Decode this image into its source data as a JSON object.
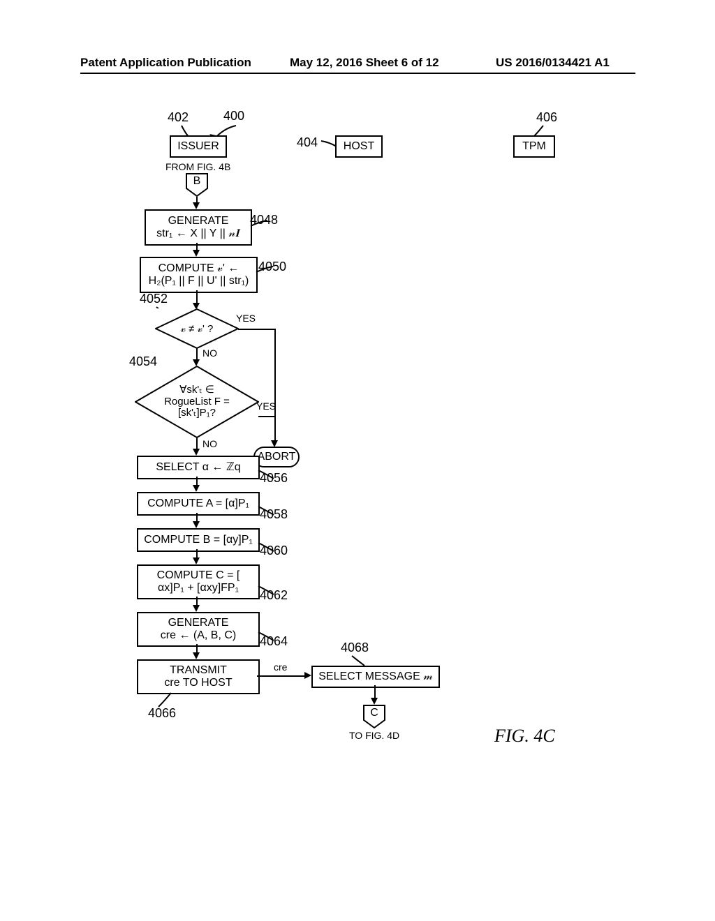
{
  "header": {
    "left": "Patent Application Publication",
    "center": "May 12, 2016   Sheet 6 of 12",
    "right": "US 2016/0134421 A1"
  },
  "entities": {
    "issuer": "ISSUER",
    "host": "HOST",
    "tpm": "TPM"
  },
  "refs": {
    "r400": "400",
    "r402": "402",
    "r404": "404",
    "r406": "406",
    "r4048": "4048",
    "r4050": "4050",
    "r4052": "4052",
    "r4054": "4054",
    "r4056": "4056",
    "r4058": "4058",
    "r4060": "4060",
    "r4062": "4062",
    "r4064": "4064",
    "r4066": "4066",
    "r4068": "4068"
  },
  "connectors": {
    "from": "FROM FIG. 4B",
    "b": "B",
    "c": "C",
    "to": "TO FIG. 4D"
  },
  "steps": {
    "s4048a": "GENERATE",
    "s4048b": "str₁ ← X || Y || 𝓃𝑰",
    "s4050a": "COMPUTE 𝓋' ←",
    "s4050b": "H₂(P₁ || F || U' || str₁)",
    "d4052": "𝓋 ≠ 𝓋' ?",
    "d4054a": "∀sk'ₜ ∈",
    "d4054b": "RogueList F =",
    "d4054c": "[sk'ₜ]P₁?",
    "abort": "ABORT",
    "s4056": "SELECT α ← ℤq",
    "s4058": "COMPUTE A = [α]P₁",
    "s4060": "COMPUTE B = [αy]P₁",
    "s4062a": "COMPUTE C = [",
    "s4062b": "αx]P₁ + [αxy]FP₁",
    "s4064a": "GENERATE",
    "s4064b": "cre ← (A, B, C)",
    "s4066a": "TRANSMIT",
    "s4066b": "cre TO HOST",
    "hmsg": "SELECT MESSAGE 𝓂",
    "creLabel": "cre"
  },
  "branch": {
    "yes": "YES",
    "no": "NO"
  },
  "figure": "FIG. 4C"
}
